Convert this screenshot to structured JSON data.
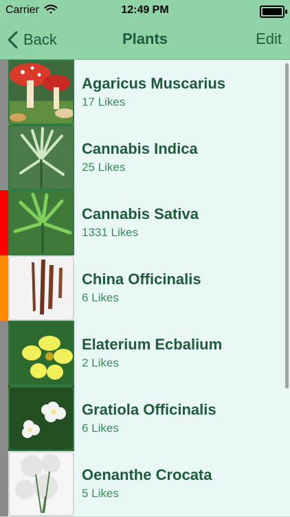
{
  "status": {
    "carrier": "Carrier",
    "time": "12:49 PM"
  },
  "nav": {
    "back_label": "Back",
    "title": "Plants",
    "edit_label": "Edit"
  },
  "rows": [
    {
      "name": "Agaricus Muscarius",
      "likes": "17 Likes",
      "stripe_color": "#8b8b8b",
      "icon": "mushroom-icon"
    },
    {
      "name": "Cannabis Indica",
      "likes": "25 Likes",
      "stripe_color": "#8b8b8b",
      "icon": "cannabis-leaf-icon"
    },
    {
      "name": "Cannabis Sativa",
      "likes": "1331 Likes",
      "stripe_color": "#ff0000",
      "icon": "cannabis-leaf-icon"
    },
    {
      "name": "China Officinalis",
      "likes": "6 Likes",
      "stripe_color": "#ff8a00",
      "icon": "bark-icon"
    },
    {
      "name": "Elaterium Ecbalium",
      "likes": "2 Likes",
      "stripe_color": "#8b8b8b",
      "icon": "yellow-flower-icon"
    },
    {
      "name": "Gratiola Officinalis",
      "likes": "6 Likes",
      "stripe_color": "#8b8b8b",
      "icon": "white-flower-icon"
    },
    {
      "name": "Oenanthe Crocata",
      "likes": "5 Likes",
      "stripe_color": "#8b8b8b",
      "icon": "umbel-flower-icon"
    }
  ],
  "colors": {
    "nav_bg": "#8fd3a6",
    "text_dark": "#1f5a3c",
    "text_light": "#3b8a5a",
    "row_bg": "#e9f8f6"
  }
}
